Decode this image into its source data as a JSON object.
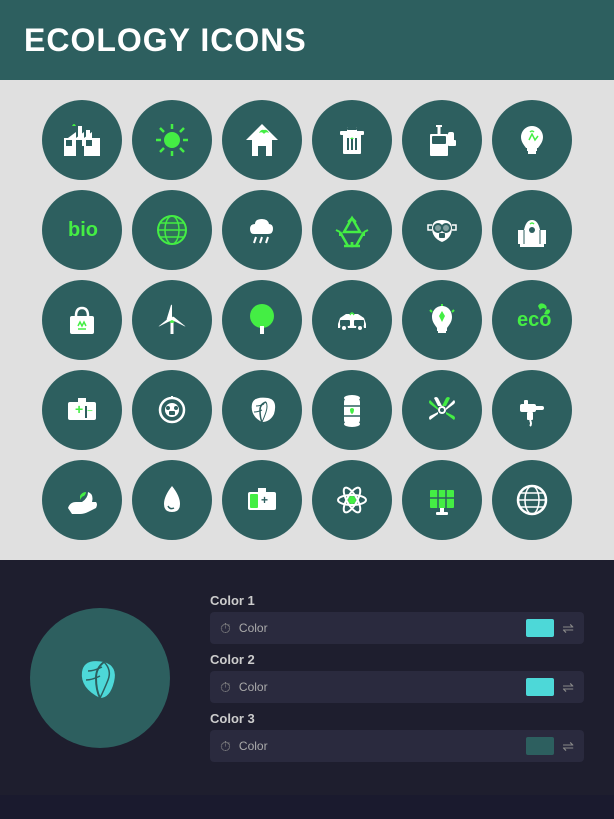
{
  "header": {
    "title": "ECOLOGY ICONS"
  },
  "colors": {
    "accent1": "#4dd8d8",
    "accent2": "#44ee44",
    "bg_circle": "#2d5f5f",
    "panel_bg": "#1e1e2e"
  },
  "color_controls": {
    "color1_label": "Color 1",
    "color1_row_label": "Color",
    "color2_label": "Color 2",
    "color2_row_label": "Color",
    "color3_label": "Color 3",
    "color3_row_label": "Color"
  },
  "icon_rows": [
    [
      "factory",
      "sun",
      "eco-house",
      "recycle-bin",
      "gas-station",
      "lightbulb"
    ],
    [
      "bio",
      "globe",
      "cloud-rain",
      "recycle",
      "gas-mask",
      "nuclear-plant"
    ],
    [
      "eco-bag",
      "wind-turbine",
      "tree",
      "eco-car",
      "energy-bulb",
      "eco-text"
    ],
    [
      "battery",
      "ev-plug",
      "leaf",
      "barrel",
      "radiation",
      "faucet"
    ],
    [
      "hand-leaf",
      "water-drop",
      "battery2",
      "atom",
      "solar-panel",
      "globe2"
    ]
  ]
}
